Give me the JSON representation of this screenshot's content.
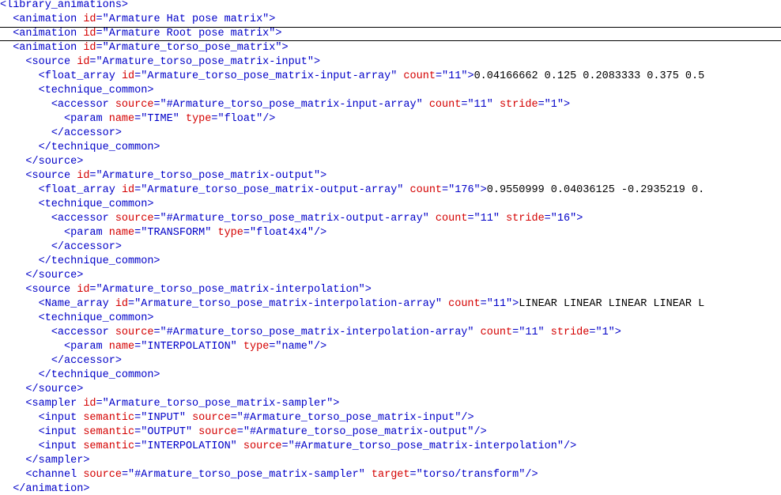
{
  "editor": {
    "current_line_index": 2,
    "colors": {
      "tag": "#0000c8",
      "attribute": "#d40000",
      "value": "#0000c8",
      "text": "#000000",
      "background": "#ffffff"
    },
    "lines": [
      {
        "indent": "",
        "tokens": [
          [
            "b",
            "<library_animations>"
          ]
        ]
      },
      {
        "indent": "  ",
        "tokens": [
          [
            "b",
            "<animation "
          ],
          [
            "a",
            "id"
          ],
          [
            "b",
            "="
          ],
          [
            "v",
            "\"Armature Hat pose matrix\""
          ],
          [
            "b",
            ">"
          ]
        ]
      },
      {
        "indent": "  ",
        "tokens": [
          [
            "b",
            "<animation "
          ],
          [
            "a",
            "id"
          ],
          [
            "b",
            "="
          ],
          [
            "v",
            "\"Armature Root pose matrix\""
          ],
          [
            "b",
            ">"
          ]
        ]
      },
      {
        "indent": "  ",
        "tokens": [
          [
            "b",
            "<animation "
          ],
          [
            "a",
            "id"
          ],
          [
            "b",
            "="
          ],
          [
            "v",
            "\"Armature_torso_pose_matrix\""
          ],
          [
            "b",
            ">"
          ]
        ]
      },
      {
        "indent": "    ",
        "tokens": [
          [
            "b",
            "<source "
          ],
          [
            "a",
            "id"
          ],
          [
            "b",
            "="
          ],
          [
            "v",
            "\"Armature_torso_pose_matrix-input\""
          ],
          [
            "b",
            ">"
          ]
        ]
      },
      {
        "indent": "      ",
        "tokens": [
          [
            "b",
            "<float_array "
          ],
          [
            "a",
            "id"
          ],
          [
            "b",
            "="
          ],
          [
            "v",
            "\"Armature_torso_pose_matrix-input-array\""
          ],
          [
            "b",
            " "
          ],
          [
            "a",
            "count"
          ],
          [
            "b",
            "="
          ],
          [
            "v",
            "\"11\""
          ],
          [
            "b",
            ">"
          ],
          [
            "t",
            "0.04166662 0.125 0.2083333 0.375 0.5"
          ]
        ]
      },
      {
        "indent": "      ",
        "tokens": [
          [
            "b",
            "<technique_common>"
          ]
        ]
      },
      {
        "indent": "        ",
        "tokens": [
          [
            "b",
            "<accessor "
          ],
          [
            "a",
            "source"
          ],
          [
            "b",
            "="
          ],
          [
            "v",
            "\"#Armature_torso_pose_matrix-input-array\""
          ],
          [
            "b",
            " "
          ],
          [
            "a",
            "count"
          ],
          [
            "b",
            "="
          ],
          [
            "v",
            "\"11\""
          ],
          [
            "b",
            " "
          ],
          [
            "a",
            "stride"
          ],
          [
            "b",
            "="
          ],
          [
            "v",
            "\"1\""
          ],
          [
            "b",
            ">"
          ]
        ]
      },
      {
        "indent": "          ",
        "tokens": [
          [
            "b",
            "<param "
          ],
          [
            "a",
            "name"
          ],
          [
            "b",
            "="
          ],
          [
            "v",
            "\"TIME\""
          ],
          [
            "b",
            " "
          ],
          [
            "a",
            "type"
          ],
          [
            "b",
            "="
          ],
          [
            "v",
            "\"float\""
          ],
          [
            "b",
            "/>"
          ]
        ]
      },
      {
        "indent": "        ",
        "tokens": [
          [
            "b",
            "</accessor>"
          ]
        ]
      },
      {
        "indent": "      ",
        "tokens": [
          [
            "b",
            "</technique_common>"
          ]
        ]
      },
      {
        "indent": "    ",
        "tokens": [
          [
            "b",
            "</source>"
          ]
        ]
      },
      {
        "indent": "    ",
        "tokens": [
          [
            "b",
            "<source "
          ],
          [
            "a",
            "id"
          ],
          [
            "b",
            "="
          ],
          [
            "v",
            "\"Armature_torso_pose_matrix-output\""
          ],
          [
            "b",
            ">"
          ]
        ]
      },
      {
        "indent": "      ",
        "tokens": [
          [
            "b",
            "<float_array "
          ],
          [
            "a",
            "id"
          ],
          [
            "b",
            "="
          ],
          [
            "v",
            "\"Armature_torso_pose_matrix-output-array\""
          ],
          [
            "b",
            " "
          ],
          [
            "a",
            "count"
          ],
          [
            "b",
            "="
          ],
          [
            "v",
            "\"176\""
          ],
          [
            "b",
            ">"
          ],
          [
            "t",
            "0.9550999 0.04036125 -0.2935219 0."
          ]
        ]
      },
      {
        "indent": "      ",
        "tokens": [
          [
            "b",
            "<technique_common>"
          ]
        ]
      },
      {
        "indent": "        ",
        "tokens": [
          [
            "b",
            "<accessor "
          ],
          [
            "a",
            "source"
          ],
          [
            "b",
            "="
          ],
          [
            "v",
            "\"#Armature_torso_pose_matrix-output-array\""
          ],
          [
            "b",
            " "
          ],
          [
            "a",
            "count"
          ],
          [
            "b",
            "="
          ],
          [
            "v",
            "\"11\""
          ],
          [
            "b",
            " "
          ],
          [
            "a",
            "stride"
          ],
          [
            "b",
            "="
          ],
          [
            "v",
            "\"16\""
          ],
          [
            "b",
            ">"
          ]
        ]
      },
      {
        "indent": "          ",
        "tokens": [
          [
            "b",
            "<param "
          ],
          [
            "a",
            "name"
          ],
          [
            "b",
            "="
          ],
          [
            "v",
            "\"TRANSFORM\""
          ],
          [
            "b",
            " "
          ],
          [
            "a",
            "type"
          ],
          [
            "b",
            "="
          ],
          [
            "v",
            "\"float4x4\""
          ],
          [
            "b",
            "/>"
          ]
        ]
      },
      {
        "indent": "        ",
        "tokens": [
          [
            "b",
            "</accessor>"
          ]
        ]
      },
      {
        "indent": "      ",
        "tokens": [
          [
            "b",
            "</technique_common>"
          ]
        ]
      },
      {
        "indent": "    ",
        "tokens": [
          [
            "b",
            "</source>"
          ]
        ]
      },
      {
        "indent": "    ",
        "tokens": [
          [
            "b",
            "<source "
          ],
          [
            "a",
            "id"
          ],
          [
            "b",
            "="
          ],
          [
            "v",
            "\"Armature_torso_pose_matrix-interpolation\""
          ],
          [
            "b",
            ">"
          ]
        ]
      },
      {
        "indent": "      ",
        "tokens": [
          [
            "b",
            "<Name_array "
          ],
          [
            "a",
            "id"
          ],
          [
            "b",
            "="
          ],
          [
            "v",
            "\"Armature_torso_pose_matrix-interpolation-array\""
          ],
          [
            "b",
            " "
          ],
          [
            "a",
            "count"
          ],
          [
            "b",
            "="
          ],
          [
            "v",
            "\"11\""
          ],
          [
            "b",
            ">"
          ],
          [
            "t",
            "LINEAR LINEAR LINEAR LINEAR L"
          ]
        ]
      },
      {
        "indent": "      ",
        "tokens": [
          [
            "b",
            "<technique_common>"
          ]
        ]
      },
      {
        "indent": "        ",
        "tokens": [
          [
            "b",
            "<accessor "
          ],
          [
            "a",
            "source"
          ],
          [
            "b",
            "="
          ],
          [
            "v",
            "\"#Armature_torso_pose_matrix-interpolation-array\""
          ],
          [
            "b",
            " "
          ],
          [
            "a",
            "count"
          ],
          [
            "b",
            "="
          ],
          [
            "v",
            "\"11\""
          ],
          [
            "b",
            " "
          ],
          [
            "a",
            "stride"
          ],
          [
            "b",
            "="
          ],
          [
            "v",
            "\"1\""
          ],
          [
            "b",
            ">"
          ]
        ]
      },
      {
        "indent": "          ",
        "tokens": [
          [
            "b",
            "<param "
          ],
          [
            "a",
            "name"
          ],
          [
            "b",
            "="
          ],
          [
            "v",
            "\"INTERPOLATION\""
          ],
          [
            "b",
            " "
          ],
          [
            "a",
            "type"
          ],
          [
            "b",
            "="
          ],
          [
            "v",
            "\"name\""
          ],
          [
            "b",
            "/>"
          ]
        ]
      },
      {
        "indent": "        ",
        "tokens": [
          [
            "b",
            "</accessor>"
          ]
        ]
      },
      {
        "indent": "      ",
        "tokens": [
          [
            "b",
            "</technique_common>"
          ]
        ]
      },
      {
        "indent": "    ",
        "tokens": [
          [
            "b",
            "</source>"
          ]
        ]
      },
      {
        "indent": "    ",
        "tokens": [
          [
            "b",
            "<sampler "
          ],
          [
            "a",
            "id"
          ],
          [
            "b",
            "="
          ],
          [
            "v",
            "\"Armature_torso_pose_matrix-sampler\""
          ],
          [
            "b",
            ">"
          ]
        ]
      },
      {
        "indent": "      ",
        "tokens": [
          [
            "b",
            "<input "
          ],
          [
            "a",
            "semantic"
          ],
          [
            "b",
            "="
          ],
          [
            "v",
            "\"INPUT\""
          ],
          [
            "b",
            " "
          ],
          [
            "a",
            "source"
          ],
          [
            "b",
            "="
          ],
          [
            "v",
            "\"#Armature_torso_pose_matrix-input\""
          ],
          [
            "b",
            "/>"
          ]
        ]
      },
      {
        "indent": "      ",
        "tokens": [
          [
            "b",
            "<input "
          ],
          [
            "a",
            "semantic"
          ],
          [
            "b",
            "="
          ],
          [
            "v",
            "\"OUTPUT\""
          ],
          [
            "b",
            " "
          ],
          [
            "a",
            "source"
          ],
          [
            "b",
            "="
          ],
          [
            "v",
            "\"#Armature_torso_pose_matrix-output\""
          ],
          [
            "b",
            "/>"
          ]
        ]
      },
      {
        "indent": "      ",
        "tokens": [
          [
            "b",
            "<input "
          ],
          [
            "a",
            "semantic"
          ],
          [
            "b",
            "="
          ],
          [
            "v",
            "\"INTERPOLATION\""
          ],
          [
            "b",
            " "
          ],
          [
            "a",
            "source"
          ],
          [
            "b",
            "="
          ],
          [
            "v",
            "\"#Armature_torso_pose_matrix-interpolation\""
          ],
          [
            "b",
            "/>"
          ]
        ]
      },
      {
        "indent": "    ",
        "tokens": [
          [
            "b",
            "</sampler>"
          ]
        ]
      },
      {
        "indent": "    ",
        "tokens": [
          [
            "b",
            "<channel "
          ],
          [
            "a",
            "source"
          ],
          [
            "b",
            "="
          ],
          [
            "v",
            "\"#Armature_torso_pose_matrix-sampler\""
          ],
          [
            "b",
            " "
          ],
          [
            "a",
            "target"
          ],
          [
            "b",
            "="
          ],
          [
            "v",
            "\"torso/transform\""
          ],
          [
            "b",
            "/>"
          ]
        ]
      },
      {
        "indent": "  ",
        "tokens": [
          [
            "b",
            "</animation>"
          ]
        ]
      }
    ]
  }
}
